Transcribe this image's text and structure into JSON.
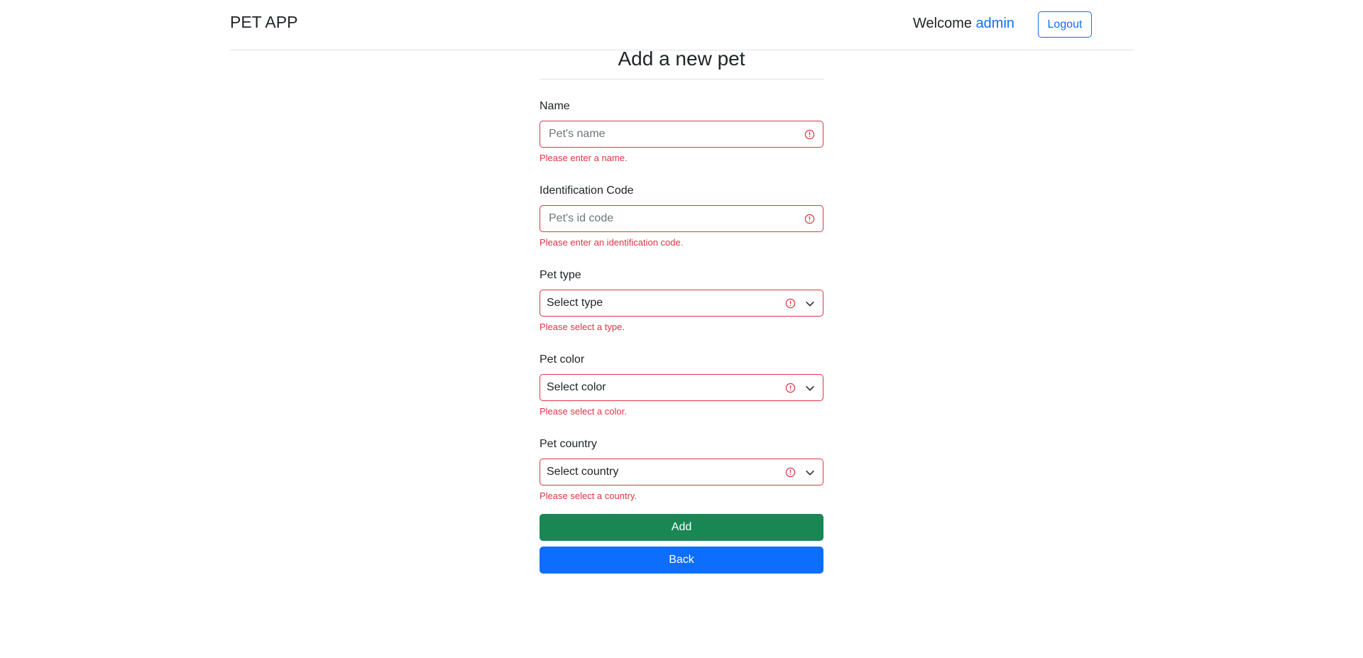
{
  "header": {
    "brand": "PET APP",
    "welcome_text": "Welcome",
    "username": "admin",
    "logout_label": "Logout"
  },
  "form": {
    "title": "Add a new pet",
    "name": {
      "label": "Name",
      "placeholder": "Pet's name",
      "error": "Please enter a name."
    },
    "id_code": {
      "label": "Identification Code",
      "placeholder": "Pet's id code",
      "error": "Please enter an identification code."
    },
    "type": {
      "label": "Pet type",
      "selected": "Select type",
      "error": "Please select a type."
    },
    "color": {
      "label": "Pet color",
      "selected": "Select color",
      "error": "Please select a color."
    },
    "country": {
      "label": "Pet country",
      "selected": "Select country",
      "error": "Please select a country."
    },
    "add_label": "Add",
    "back_label": "Back"
  },
  "icons": {
    "invalid": "exclamation-circle-icon",
    "dropdown": "chevron-down-icon"
  },
  "colors": {
    "primary": "#0d6efd",
    "success": "#198754",
    "danger": "#dc3545",
    "border": "#dee2e6"
  }
}
